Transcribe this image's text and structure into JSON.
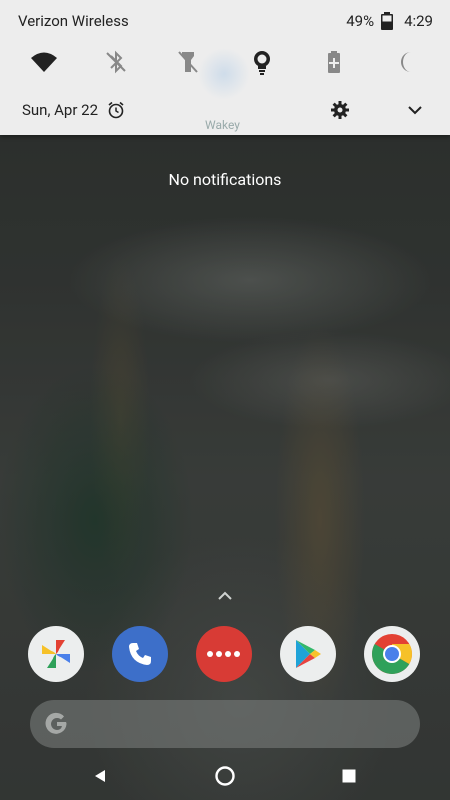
{
  "status_bar": {
    "carrier": "Verizon Wireless",
    "battery_percent": "49%",
    "time": "4:29"
  },
  "quick_settings": {
    "tiles": [
      {
        "icon": "wifi-icon",
        "state": "on"
      },
      {
        "icon": "bluetooth-off-icon",
        "state": "off"
      },
      {
        "icon": "flashlight-off-icon",
        "state": "off"
      },
      {
        "icon": "lightbulb-icon",
        "state": "on"
      },
      {
        "icon": "battery-saver-icon",
        "state": "off"
      },
      {
        "icon": "night-mode-icon",
        "state": "off"
      }
    ],
    "date": "Sun, Apr 22",
    "background_ghost_label": "Wakey"
  },
  "notifications": {
    "empty_text": "No notifications"
  },
  "dock": {
    "apps": [
      "Photos",
      "Phone",
      "Messages",
      "Play Store",
      "Chrome"
    ]
  },
  "colors": {
    "shade_bg": "#ededed",
    "phone_blue": "#3d6fc9",
    "messages_red": "#d83b35",
    "search_bar": "#7a7e7c"
  }
}
